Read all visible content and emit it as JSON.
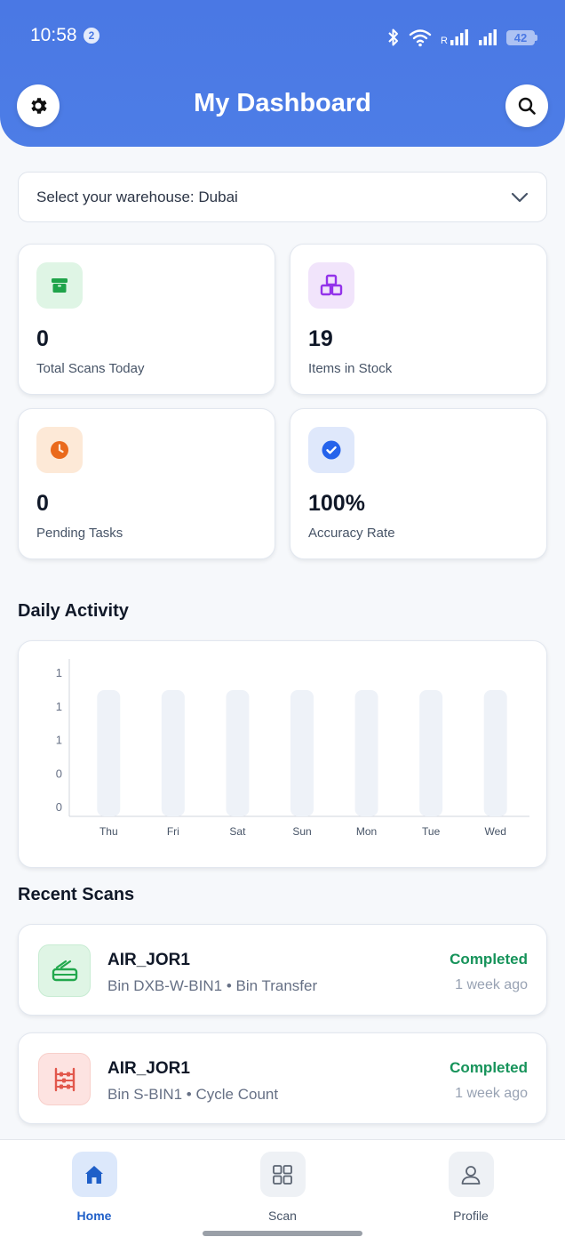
{
  "status_bar": {
    "time": "10:58",
    "notification_count": "2",
    "battery": "42",
    "signal_roaming": "R"
  },
  "header": {
    "title": "My Dashboard"
  },
  "warehouse": {
    "label": "Select your warehouse: Dubai"
  },
  "stats": [
    {
      "value": "0",
      "label": "Total Scans Today",
      "icon": "box-icon",
      "color": "#1fa34a",
      "bg": "#dff5e5"
    },
    {
      "value": "19",
      "label": "Items in Stock",
      "icon": "cubes-icon",
      "color": "#9333ea",
      "bg": "#f1e4fb"
    },
    {
      "value": "0",
      "label": "Pending Tasks",
      "icon": "clock-icon",
      "color": "#ea6a1c",
      "bg": "#fde9d7"
    },
    {
      "value": "100%",
      "label": "Accuracy Rate",
      "icon": "check-circle-icon",
      "color": "#2563eb",
      "bg": "#dfe8fb"
    }
  ],
  "daily_activity": {
    "title": "Daily Activity"
  },
  "chart_data": {
    "type": "bar",
    "title": "",
    "xlabel": "",
    "ylabel": "",
    "categories": [
      "Thu",
      "Fri",
      "Sat",
      "Sun",
      "Mon",
      "Tue",
      "Wed"
    ],
    "values": [
      0,
      0,
      0,
      0,
      0,
      0,
      0
    ],
    "y_tick_labels": [
      "1",
      "1",
      "1",
      "0",
      "0"
    ],
    "ylim": [
      0,
      1
    ],
    "grid": false,
    "bar_color": "#eef2f8"
  },
  "recent_scans": {
    "title": "Recent Scans",
    "items": [
      {
        "name": "AIR_JOR1",
        "sub": "Bin DXB-W-BIN1 • Bin Transfer",
        "status": "Completed",
        "time": "1 week ago",
        "icon": "transfer-icon",
        "color": "#22a84d",
        "bg": "#dff5e5"
      },
      {
        "name": "AIR_JOR1",
        "sub": "Bin S-BIN1 • Cycle Count",
        "status": "Completed",
        "time": "1 week ago",
        "icon": "abacus-icon",
        "color": "#e2574c",
        "bg": "#fde3e1"
      }
    ]
  },
  "nav": [
    {
      "label": "Home",
      "icon": "home-icon",
      "active": true
    },
    {
      "label": "Scan",
      "icon": "grid-icon",
      "active": false
    },
    {
      "label": "Profile",
      "icon": "user-icon",
      "active": false
    }
  ]
}
